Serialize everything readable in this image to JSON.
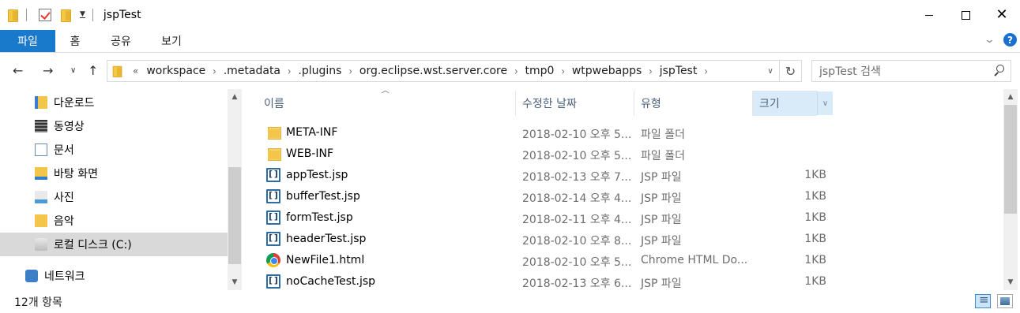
{
  "window": {
    "title": "jspTest",
    "controls": {
      "minimize": "—",
      "maximize": "☐",
      "close": "✕"
    }
  },
  "ribbon": {
    "tabs": [
      "파일",
      "홈",
      "공유",
      "보기"
    ],
    "help": "?"
  },
  "address": {
    "overflow": "«",
    "crumbs": [
      "workspace",
      ".metadata",
      ".plugins",
      "org.eclipse.wst.server.core",
      "tmp0",
      "wtpwebapps",
      "jspTest"
    ],
    "search_placeholder": "jspTest 검색"
  },
  "nav": {
    "items": [
      {
        "label": "다운로드",
        "icon": "download-folder-icon"
      },
      {
        "label": "동영상",
        "icon": "video-folder-icon"
      },
      {
        "label": "문서",
        "icon": "documents-folder-icon"
      },
      {
        "label": "바탕 화면",
        "icon": "desktop-folder-icon"
      },
      {
        "label": "사진",
        "icon": "pictures-folder-icon"
      },
      {
        "label": "음악",
        "icon": "music-folder-icon"
      },
      {
        "label": "로컬 디스크 (C:)",
        "icon": "local-disk-icon",
        "selected": true
      },
      {
        "label": "네트워크",
        "icon": "network-icon"
      }
    ]
  },
  "columns": {
    "name": "이름",
    "date": "수정한 날짜",
    "type": "유형",
    "size": "크기"
  },
  "files": [
    {
      "name": "META-INF",
      "date": "2018-02-10 오후 5...",
      "type": "파일 폴더",
      "size": "",
      "icon": "folder-icon"
    },
    {
      "name": "WEB-INF",
      "date": "2018-02-10 오후 5...",
      "type": "파일 폴더",
      "size": "",
      "icon": "folder-icon"
    },
    {
      "name": "appTest.jsp",
      "date": "2018-02-13 오후 7...",
      "type": "JSP 파일",
      "size": "1KB",
      "icon": "jsp-file-icon"
    },
    {
      "name": "bufferTest.jsp",
      "date": "2018-02-14 오후 4...",
      "type": "JSP 파일",
      "size": "1KB",
      "icon": "jsp-file-icon"
    },
    {
      "name": "formTest.jsp",
      "date": "2018-02-11 오후 4...",
      "type": "JSP 파일",
      "size": "1KB",
      "icon": "jsp-file-icon"
    },
    {
      "name": "headerTest.jsp",
      "date": "2018-02-10 오후 8...",
      "type": "JSP 파일",
      "size": "1KB",
      "icon": "jsp-file-icon"
    },
    {
      "name": "NewFile1.html",
      "date": "2018-02-10 오후 5...",
      "type": "Chrome HTML Do...",
      "size": "1KB",
      "icon": "chrome-html-icon"
    },
    {
      "name": "noCacheTest.jsp",
      "date": "2018-02-13 오후 6...",
      "type": "JSP 파일",
      "size": "1KB",
      "icon": "jsp-file-icon"
    }
  ],
  "status": {
    "item_count": "12개 항목"
  }
}
